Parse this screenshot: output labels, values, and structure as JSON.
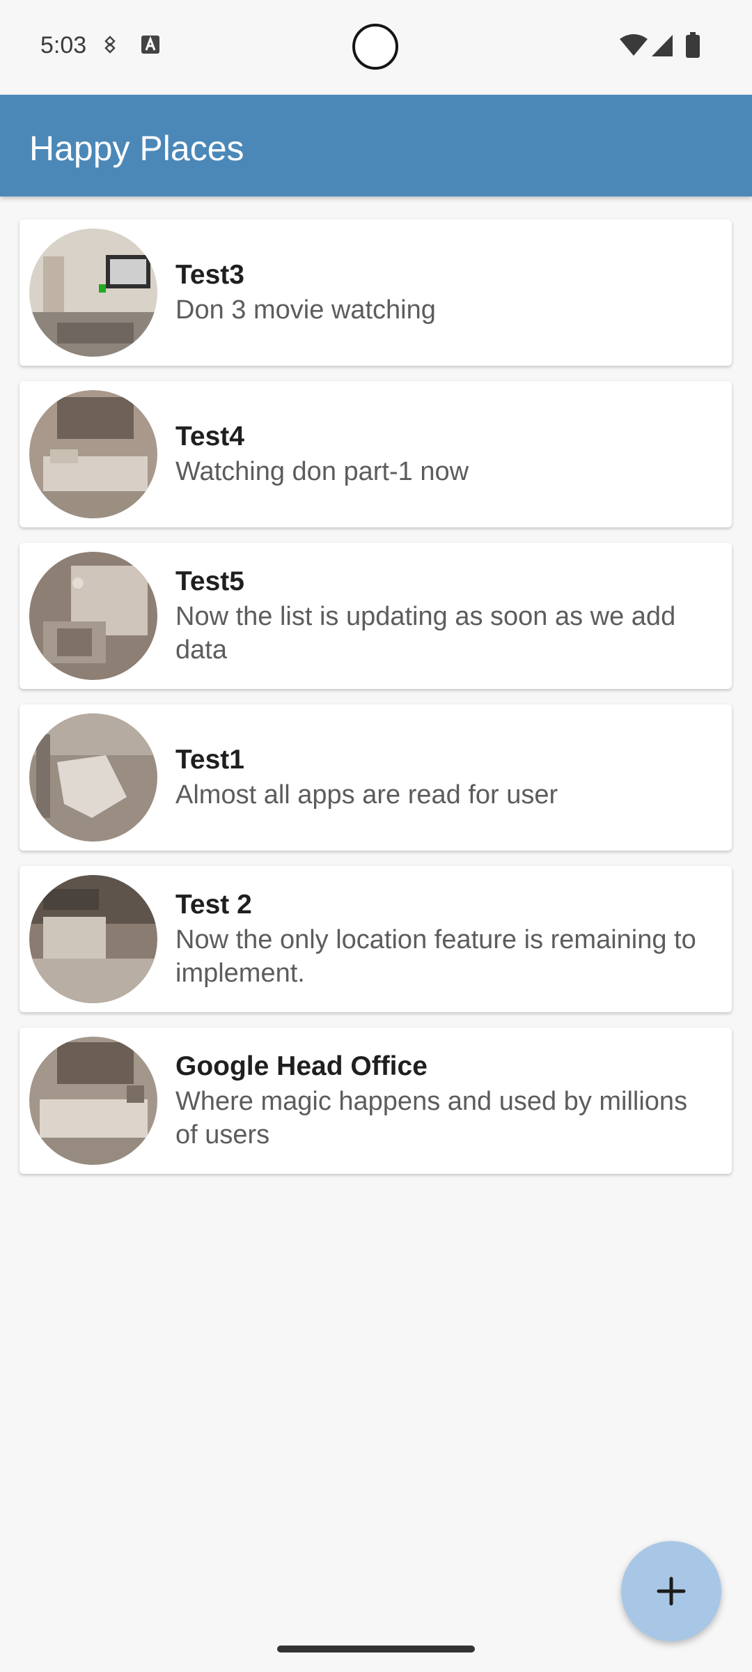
{
  "status_bar": {
    "time": "5:03",
    "icons": [
      "settings-assistant-icon",
      "a-icon",
      "wifi-icon",
      "signal-icon",
      "battery-icon"
    ]
  },
  "app_bar": {
    "title": "Happy Places",
    "color": "#4b88b8"
  },
  "places": [
    {
      "title": "Test3",
      "description": "Don 3 movie watching"
    },
    {
      "title": "Test4",
      "description": "Watching don part-1 now"
    },
    {
      "title": "Test5",
      "description": "Now the list is updating as soon as we add data"
    },
    {
      "title": "Test1",
      "description": "Almost all apps are read for user"
    },
    {
      "title": "Test 2",
      "description": "Now the only location feature is remaining to implement."
    },
    {
      "title": "Google Head Office",
      "description": "Where magic happens and used by millions of users"
    }
  ],
  "fab": {
    "icon": "plus-icon",
    "color": "#a8c7e6"
  }
}
